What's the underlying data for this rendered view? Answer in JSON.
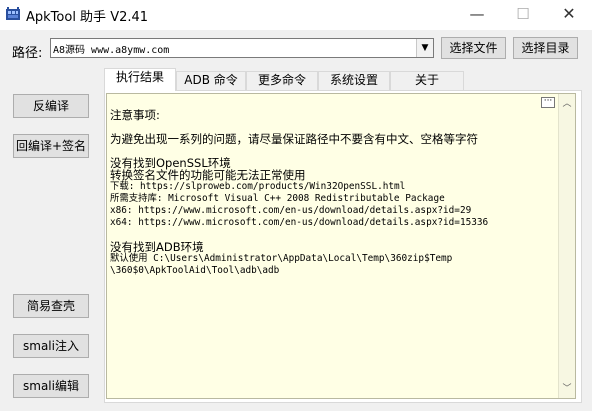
{
  "window": {
    "title": "ApkTool 助手 V2.41",
    "minimize_glyph": "—",
    "maximize_glyph": "☐",
    "close_glyph": "✕"
  },
  "path": {
    "label": "路径:",
    "value": "A8源码 www.a8ymw.com",
    "dropdown_glyph": "▼"
  },
  "toolbar": {
    "select_file_label": "选择文件",
    "select_dir_label": "选择目录"
  },
  "sidebar": {
    "decompile_label": "反编译",
    "recompile_sign_label": "回编译+签名",
    "check_shell_label": "简易查壳",
    "smali_inject_label": "smali注入",
    "smali_edit_label": "smali编辑"
  },
  "tabs": [
    {
      "label": "执行结果"
    },
    {
      "label": "ADB 命令"
    },
    {
      "label": "更多命令"
    },
    {
      "label": "系统设置"
    },
    {
      "label": "关于"
    }
  ],
  "output": {
    "lines": [
      "注意事项:",
      "为避免出现一系列的问题，请尽量保证路径中不要含有中文、空格等字符",
      "没有找到OpenSSL环境",
      "转换签名文件的功能可能无法正常使用",
      "下载: https://slproweb.com/products/Win32OpenSSL.html",
      "所需支持库: Microsoft Visual C++ 2008 Redistributable Package",
      "x86: https://www.microsoft.com/en-us/download/details.aspx?id=29",
      "x64: https://www.microsoft.com/en-us/download/details.aspx?id=15336",
      "没有找到ADB环境",
      "默认使用 C:\\Users\\Administrator\\AppData\\Local\\Temp\\360zip$Temp",
      "\\360$0\\ApkToolAid\\Tool\\adb\\adb"
    ],
    "ellipsis_glyph": "···",
    "scroll_up_glyph": "︿",
    "scroll_down_glyph": "﹀"
  },
  "colors": {
    "output_background": "#ffffe5",
    "window_background": "#f0f0f0",
    "button_face": "#e1e1e1"
  }
}
